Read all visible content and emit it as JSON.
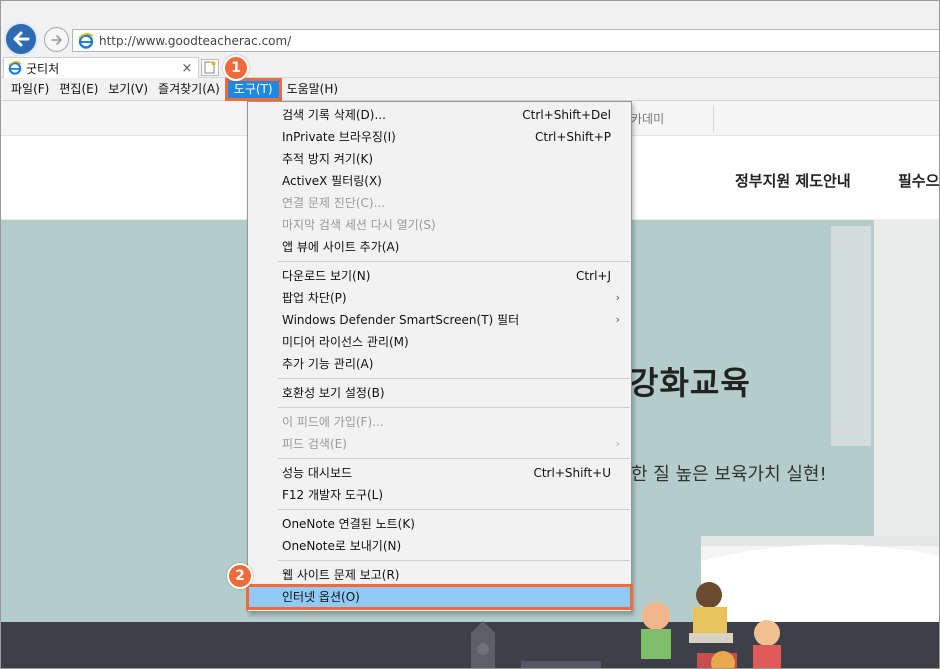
{
  "browser": {
    "url": "http://www.goodteacherac.com/",
    "tab_title": "굿티처",
    "tab_close": "×"
  },
  "menubar": {
    "items": [
      "파일(F)",
      "편집(E)",
      "보기(V)",
      "즐겨찾기(A)",
      "도구(T)",
      "도움말(H)"
    ],
    "active_index": 4
  },
  "page": {
    "top_link": "카데미",
    "nav_links": [
      "정부지원 제도안내",
      "필수으"
    ],
    "hero_title": "강화교육",
    "hero_subtitle": "한 질 높은 보육가치 실현!"
  },
  "tools_menu": {
    "groups": [
      [
        {
          "label": "검색 기록 삭제(D)...",
          "shortcut": "Ctrl+Shift+Del",
          "disabled": false
        },
        {
          "label": "InPrivate 브라우징(I)",
          "shortcut": "Ctrl+Shift+P",
          "disabled": false
        },
        {
          "label": "추적 방지 켜기(K)",
          "shortcut": "",
          "disabled": false
        },
        {
          "label": "ActiveX 필터링(X)",
          "shortcut": "",
          "disabled": false
        },
        {
          "label": "연결 문제 진단(C)...",
          "shortcut": "",
          "disabled": true
        },
        {
          "label": "마지막 검색 세션 다시 열기(S)",
          "shortcut": "",
          "disabled": true
        },
        {
          "label": "앱 뷰에 사이트 추가(A)",
          "shortcut": "",
          "disabled": false
        }
      ],
      [
        {
          "label": "다운로드 보기(N)",
          "shortcut": "Ctrl+J",
          "disabled": false
        },
        {
          "label": "팝업 차단(P)",
          "shortcut": "",
          "submenu": true,
          "disabled": false
        },
        {
          "label": "Windows Defender SmartScreen(T) 필터",
          "shortcut": "",
          "submenu": true,
          "disabled": false
        },
        {
          "label": "미디어 라이선스 관리(M)",
          "shortcut": "",
          "disabled": false
        },
        {
          "label": "추가 기능 관리(A)",
          "shortcut": "",
          "disabled": false
        }
      ],
      [
        {
          "label": "호환성 보기 설정(B)",
          "shortcut": "",
          "disabled": false
        }
      ],
      [
        {
          "label": "이 피드에 가입(F)...",
          "shortcut": "",
          "disabled": true
        },
        {
          "label": "피드 검색(E)",
          "shortcut": "",
          "submenu": true,
          "disabled": true
        }
      ],
      [
        {
          "label": "성능 대시보드",
          "shortcut": "Ctrl+Shift+U",
          "disabled": false
        },
        {
          "label": "F12 개발자 도구(L)",
          "shortcut": "",
          "disabled": false
        }
      ],
      [
        {
          "label": "OneNote 연결된 노트(K)",
          "shortcut": "",
          "disabled": false
        },
        {
          "label": "OneNote로 보내기(N)",
          "shortcut": "",
          "disabled": false
        }
      ],
      [
        {
          "label": "웹 사이트 문제 보고(R)",
          "shortcut": "",
          "disabled": false
        },
        {
          "label": "인터넷 옵션(O)",
          "shortcut": "",
          "disabled": false,
          "highlighted": true
        }
      ]
    ]
  },
  "callouts": [
    "1",
    "2"
  ],
  "colors": {
    "accent_orange": "#f06a3a",
    "menu_active_blue": "#1e88e5",
    "item_highlight": "#91c9f7"
  }
}
